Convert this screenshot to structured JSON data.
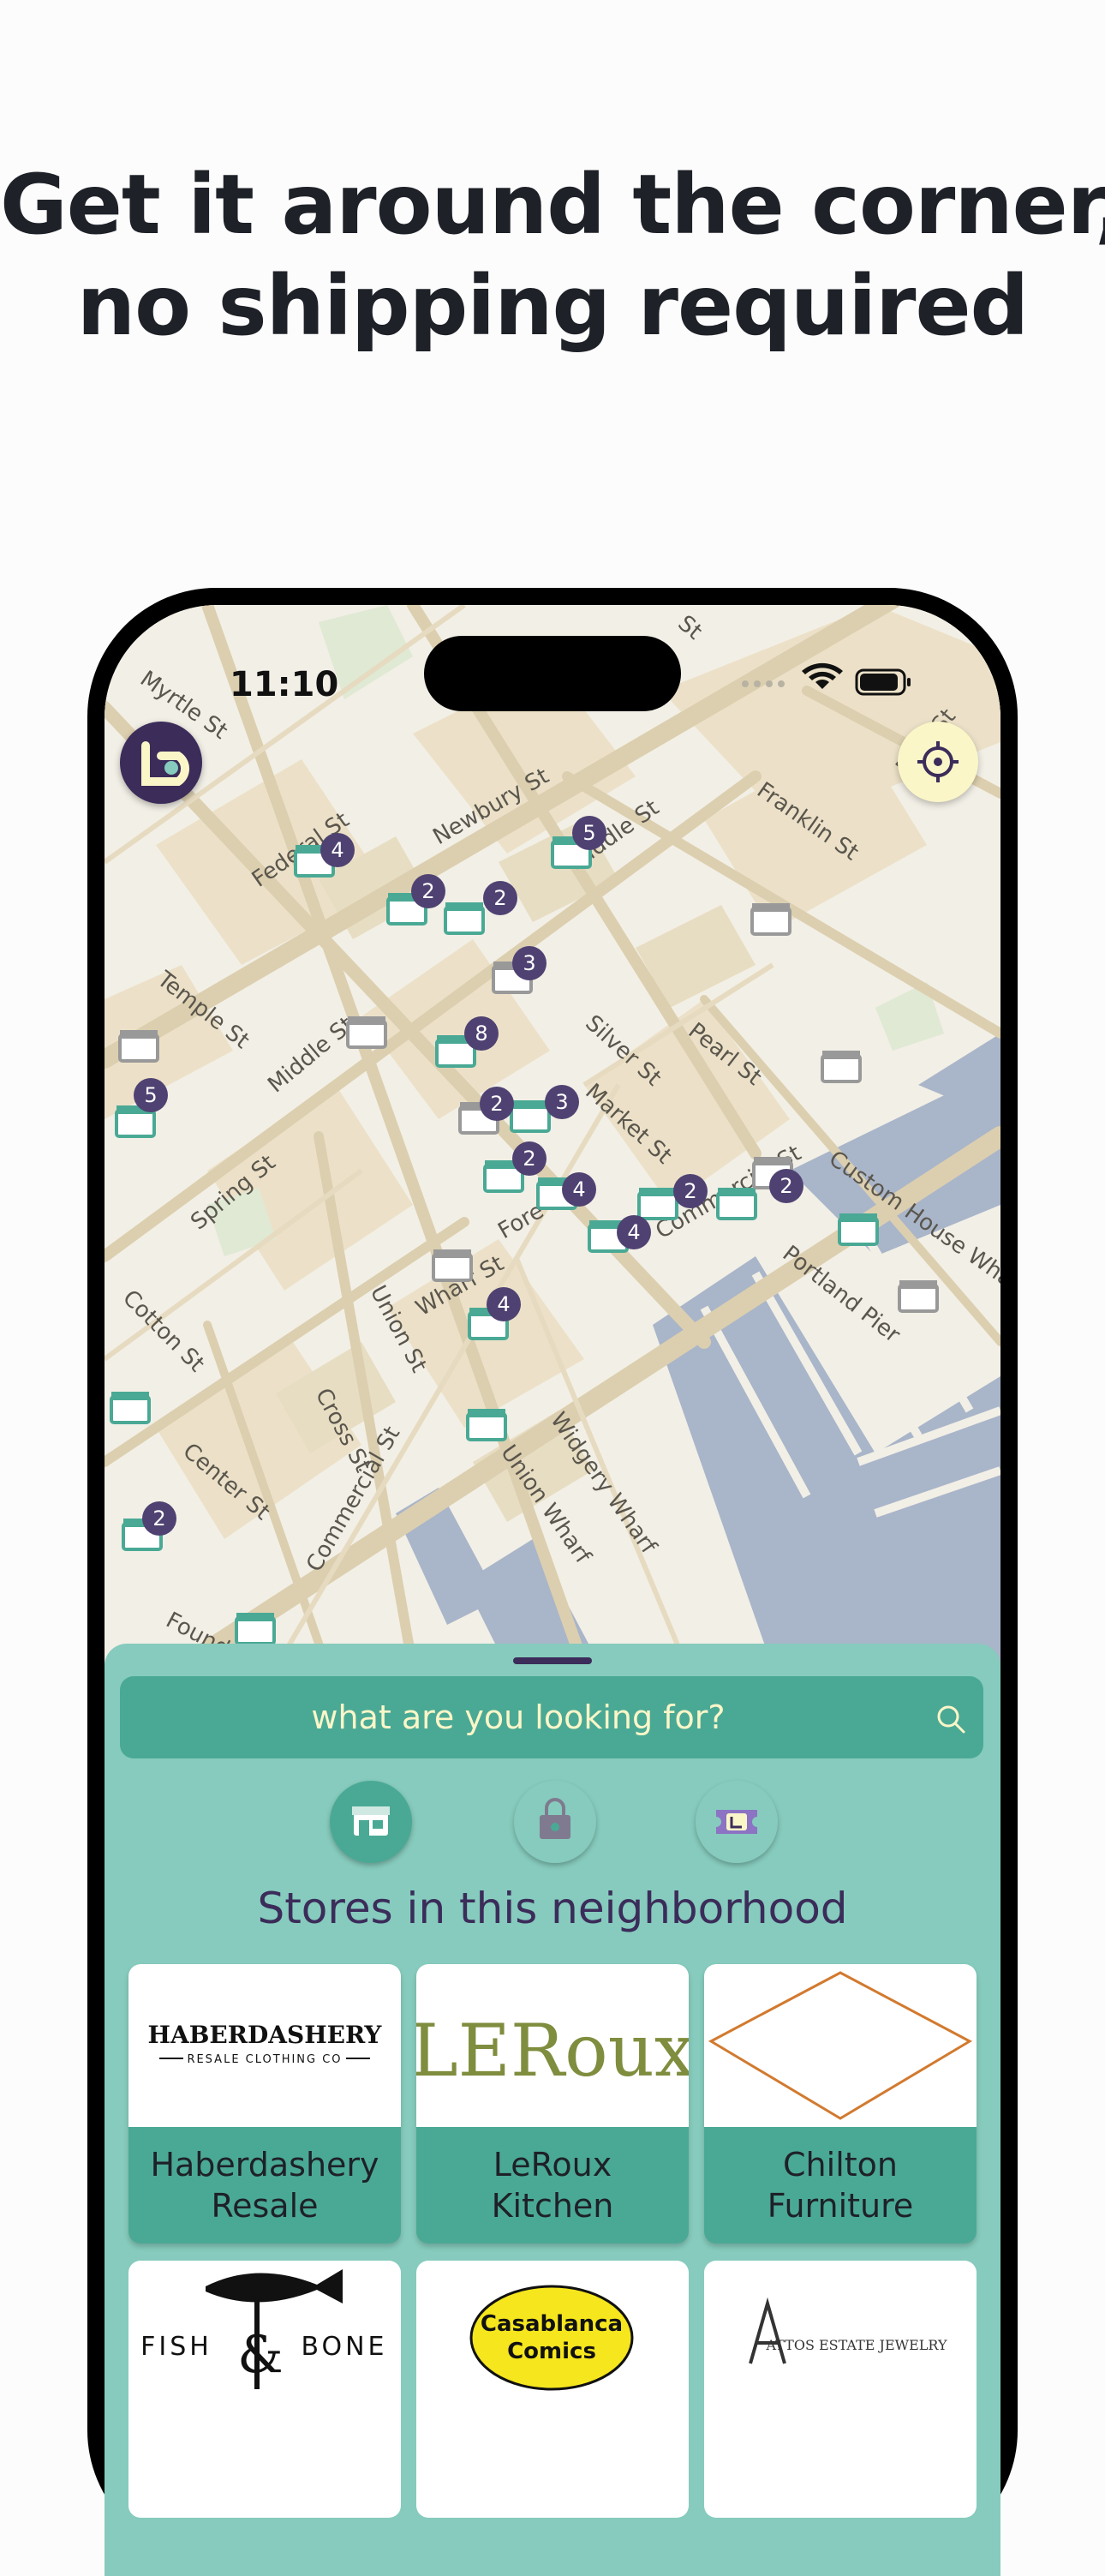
{
  "headline": {
    "line1": "Get it around the corner,",
    "line2": "no shipping required"
  },
  "status_bar": {
    "time": "11:10"
  },
  "map": {
    "streets": [
      "Myrtle St",
      "Federal St",
      "Newbury St",
      "Middle St",
      "Franklin St",
      "Fore St",
      "Temple St",
      "Middle St",
      "Silver St",
      "Pearl St",
      "Spring St",
      "Market St",
      "Commercial St",
      "Custom House Wharf",
      "Fore St",
      "Portland Pier",
      "Cotton St",
      "Union St",
      "Wharf St",
      "Cross St",
      "Widgery Wharf",
      "Union Wharf",
      "Center St",
      "Commercial St",
      "Foundry La"
    ],
    "cluster_counts": [
      "5",
      "4",
      "2",
      "2",
      "3",
      "8",
      "2",
      "3",
      "5",
      "2",
      "4",
      "2",
      "2",
      "4",
      "4",
      "2",
      "St"
    ]
  },
  "search": {
    "placeholder": "what are you looking for?"
  },
  "filters": [
    "stores",
    "bags",
    "tickets"
  ],
  "section_title": "Stores in this neighborhood",
  "stores": [
    {
      "name": "Haberdashery Resale",
      "logo_line1": "HABERDASHERY",
      "logo_line2": "RESALE CLOTHING CO"
    },
    {
      "name": "LeRoux Kitchen",
      "logo_text": "LERoux"
    },
    {
      "name": "Chilton Furniture"
    },
    {
      "name": "Fish & Bone",
      "logo_left": "FISH",
      "logo_mid": "&",
      "logo_right": "BONE"
    },
    {
      "name": "Casablanca Comics",
      "logo_line1": "Casablanca",
      "logo_line2": "Comics"
    },
    {
      "name": "Attos Estate Jewelry",
      "logo_text": "ATTOS ESTATE JEWELRY"
    }
  ],
  "colors": {
    "brand_purple": "#3b2c5a",
    "sheet_teal": "#86cbbd",
    "accent_teal": "#4aa995",
    "cream": "#fbf6c8"
  }
}
